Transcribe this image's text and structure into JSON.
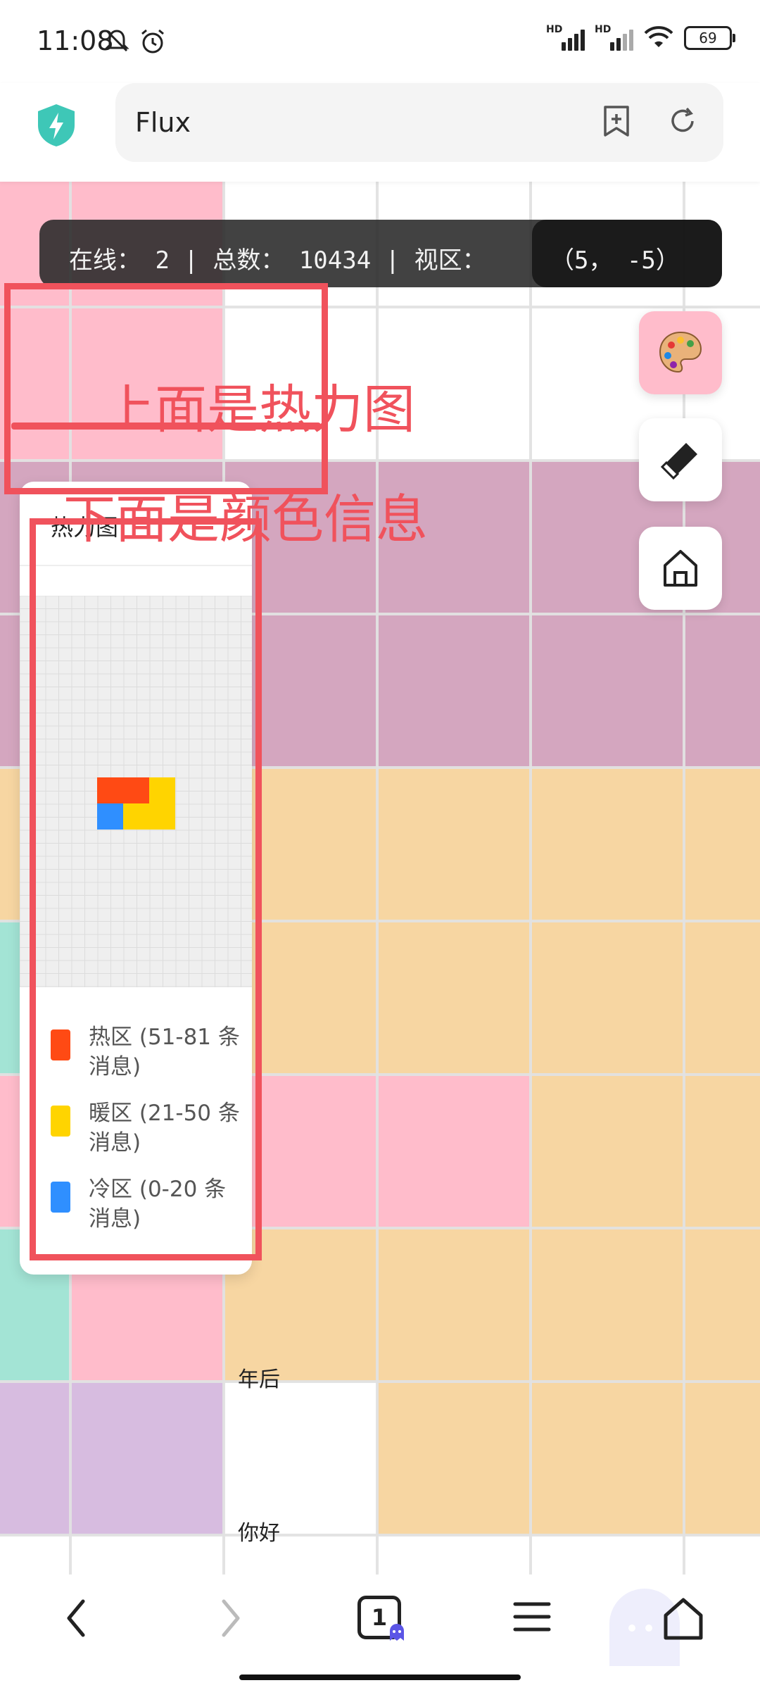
{
  "status_bar": {
    "time": "11:08",
    "signal1_label": "HD",
    "signal2_label": "HD",
    "battery": "69"
  },
  "browser": {
    "url_text": "Flux"
  },
  "stats": {
    "text": "在线： 2 | 总数： 10434 | 视区：",
    "coords": "（5， -5）"
  },
  "canvas": {
    "cell_labels": [
      "年后",
      "你好"
    ]
  },
  "annotations": {
    "above": "上面是热力图",
    "below": "下面是颜色信息"
  },
  "heatmap_panel": {
    "title": "热力图",
    "legend": [
      {
        "label": "热区 (51-81 条消息)",
        "color": "#ff4a14"
      },
      {
        "label": "暖区 (21-50 条消息)",
        "color": "#ffd400"
      },
      {
        "label": "冷区 (0-20 条消息)",
        "color": "#2f8fff"
      }
    ]
  },
  "colors": {
    "pink": "#ffbccb",
    "mauve": "#d4a6bf",
    "peach": "#f7d6a2",
    "mint": "#a3e4d5",
    "lavender": "#d7bce0",
    "annotation_red": "#f0525c"
  },
  "nav": {
    "tab_count": "1"
  }
}
